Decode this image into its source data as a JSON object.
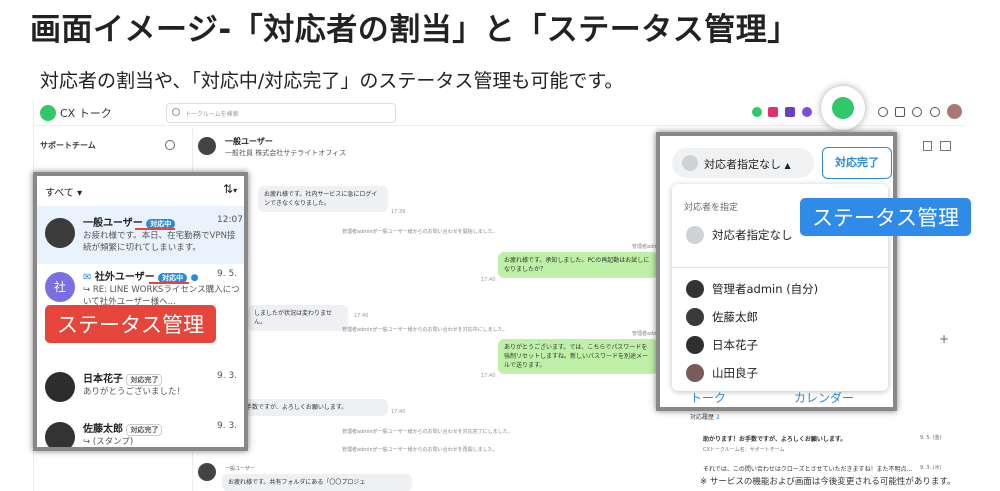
{
  "page": {
    "title": "画面イメージ-「対応者の割当」と「ステータス管理」",
    "subtitle": "対応者の割当や、「対応中/対応完了」のステータス管理も可能です。",
    "note": "※ サービスの機能および画面は今後変更される可能性があります。"
  },
  "app": {
    "name": "CX トーク",
    "search_placeholder": "トークルームを検索",
    "team_selector": "サポートチーム"
  },
  "chat": {
    "header_name": "一般ユーザー",
    "header_sub": "一般社員 株式会社サテライトオフィス",
    "messages": [
      {
        "text": "お疲れ様です。社内サービスに急にログインできなくなりました。",
        "time": "17:39"
      },
      {
        "text": "管理者adminが一般ユーザー様からのお問い合わせを開始しました。"
      },
      {
        "sender": "管理者admin",
        "text": "お疲れ様です。承知しました。PCの再起動はお試しになりましたか？",
        "time": "17:40"
      },
      {
        "text": "しましたが状況は変わりません。",
        "time": "17:40"
      },
      {
        "text": "管理者adminが一般ユーザー様からのお問い合わせを対応中にしました。"
      },
      {
        "sender": "管理者admin",
        "text": "ありがとうございます。では、こちらでパスワードを強制リセットしますね。新しいパスワードを別途メールで送ります。",
        "time": "17:40"
      },
      {
        "text": "助かります！お手数ですが、よろしくお願いします。",
        "time": "17:40"
      },
      {
        "text": "管理者adminが一般ユーザー様からのお問い合わせを対応完了にしました。"
      },
      {
        "text": "管理者adminが一般ユーザー様からのお問い合わせを再開しました。"
      },
      {
        "sender": "一般ユーザー",
        "text": "お疲れ様です。共有フォルダにある「〇〇プロジェ"
      }
    ]
  },
  "left_panel": {
    "filter": "すべて",
    "items": [
      {
        "name": "一般ユーザー",
        "badge": "対応中",
        "time": "12:07",
        "msg": "お疲れ様です。本日、在宅勤務でVPN接続が頻繁に切れてしまいます。"
      },
      {
        "name": "社外ユーザー",
        "badge": "対応中",
        "time": "9. 5.",
        "msg": "RE: LINE WORKSライセンス購入について社外ユーザー様へ..."
      },
      {
        "name": "日本花子",
        "badge": "対応完了",
        "time": "9. 3.",
        "msg": "ありがとうございました！"
      },
      {
        "name": "佐藤太郎",
        "badge": "対応完了",
        "time": "9. 3.",
        "msg": "(スタンプ)"
      }
    ],
    "avatar_text": "社",
    "status_label": "ステータス管理"
  },
  "right_panel": {
    "assign_label": "対応者指定なし",
    "done_button": "対応完了",
    "dropdown_header": "対応者を指定",
    "options": [
      "対応者指定なし",
      "管理者admin (自分)",
      "佐藤太郎",
      "日本花子",
      "山田良子"
    ],
    "tabs": [
      "トーク",
      "カレンダー"
    ],
    "status_label": "ステータス管理"
  },
  "history": {
    "header": "対応履歴",
    "count": "2",
    "items": [
      {
        "text": "助かります！お手数ですが、よろしくお願いします。",
        "date": "9. 5. (金)",
        "room": "CXトークルーム名：サポートチーム"
      },
      {
        "text": "それでは、この問い合わせはクローズとさせていただきますね！また不明点...",
        "date": "9. 3. (水)"
      }
    ]
  },
  "colors": {
    "red": "#e5453a",
    "blue": "#2f8be8",
    "green": "#bff0a8",
    "accent": "#2b8ad6"
  }
}
